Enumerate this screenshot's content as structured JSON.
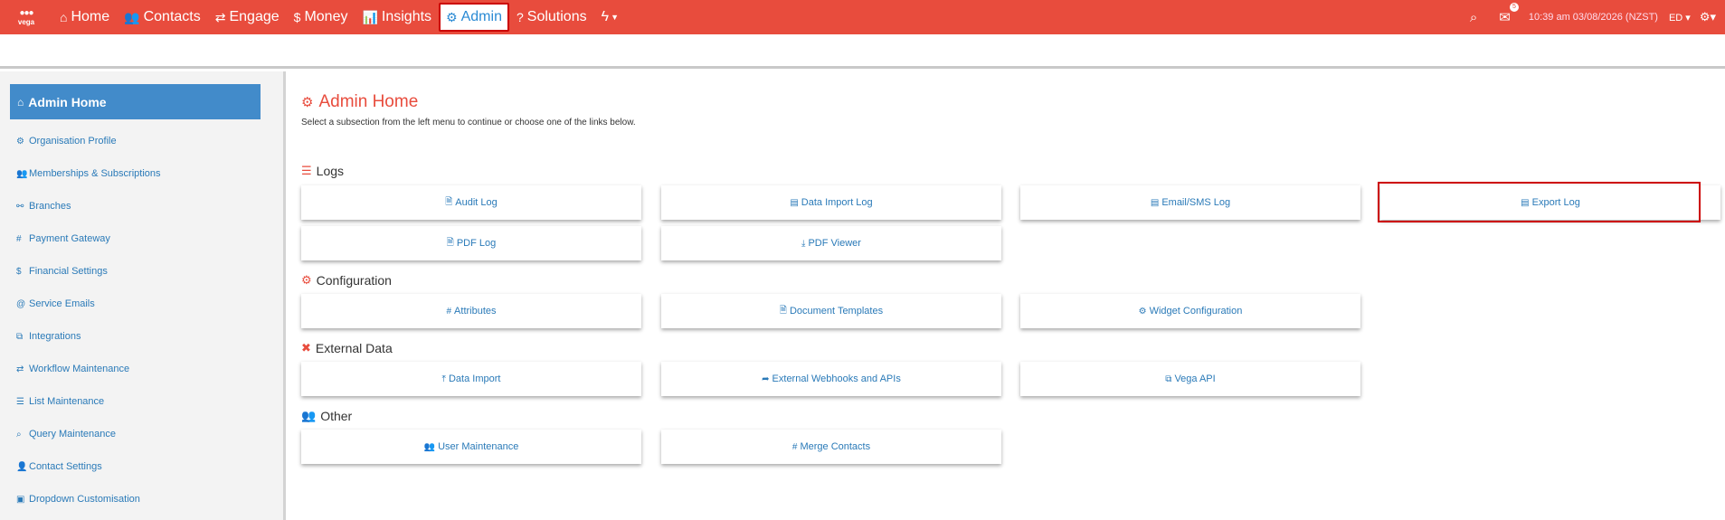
{
  "logo": {
    "word": "vega"
  },
  "nav": {
    "items": [
      {
        "icon": "⌂",
        "label": "Home"
      },
      {
        "icon": "👥",
        "label": "Contacts"
      },
      {
        "icon": "⇄",
        "label": "Engage"
      },
      {
        "icon": "$",
        "label": "Money"
      },
      {
        "icon": "📊",
        "label": "Insights"
      },
      {
        "icon": "⚙",
        "label": "Admin"
      },
      {
        "icon": "?",
        "label": "Solutions"
      }
    ],
    "quick_icon": "ϟ"
  },
  "topright": {
    "notifications_badge": "5",
    "datetime": "10:39 am 03/08/2026 (NZST)",
    "user": "ED"
  },
  "sidebar": {
    "home_label": "Admin Home",
    "items": [
      {
        "icon": "⚙",
        "label": "Organisation Profile"
      },
      {
        "icon": "👥",
        "label": "Memberships & Subscriptions"
      },
      {
        "icon": "⚯",
        "label": "Branches"
      },
      {
        "icon": "#",
        "label": "Payment Gateway"
      },
      {
        "icon": "$",
        "label": "Financial Settings"
      },
      {
        "icon": "@",
        "label": "Service Emails"
      },
      {
        "icon": "⧉",
        "label": "Integrations"
      },
      {
        "icon": "⇄",
        "label": "Workflow Maintenance"
      },
      {
        "icon": "☰",
        "label": "List Maintenance"
      },
      {
        "icon": "⌕",
        "label": "Query Maintenance"
      },
      {
        "icon": "👤",
        "label": "Contact Settings"
      },
      {
        "icon": "▣",
        "label": "Dropdown Customisation"
      }
    ]
  },
  "main": {
    "title": "Admin Home",
    "intro": "Select a subsection from the left menu to continue or choose one of the links below.",
    "sections": {
      "logs": {
        "title": "Logs",
        "cards": [
          "Audit Log",
          "Data Import Log",
          "Email/SMS Log",
          "Export Log",
          "PDF Log",
          "PDF Viewer"
        ]
      },
      "configuration": {
        "title": "Configuration",
        "cards": [
          "Attributes",
          "Document Templates",
          "Widget Configuration"
        ]
      },
      "external": {
        "title": "External Data",
        "cards": [
          "Data Import",
          "External Webhooks and APIs",
          "Vega API"
        ]
      },
      "other": {
        "title": "Other",
        "cards": [
          "User Maintenance",
          "Merge Contacts"
        ]
      }
    }
  }
}
